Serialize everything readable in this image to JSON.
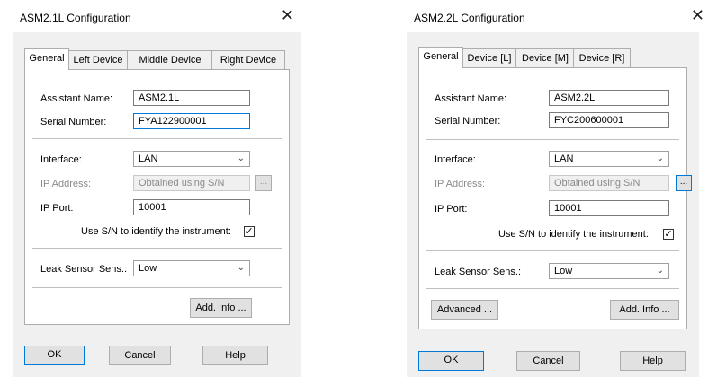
{
  "dialog1": {
    "title": "ASM2.1L Configuration",
    "close": "✕",
    "tabs": [
      "General",
      "Left Device",
      "Middle Device",
      "Right Device"
    ],
    "assistant_name_label": "Assistant Name:",
    "assistant_name_value": "ASM2.1L",
    "serial_number_label": "Serial Number:",
    "serial_number_value": "FYA122900001",
    "interface_label": "Interface:",
    "interface_value": "LAN",
    "ip_address_label": "IP Address:",
    "ip_address_value": "Obtained using S/N",
    "browse_label": "...",
    "ip_port_label": "IP Port:",
    "ip_port_value": "10001",
    "use_sn_label": "Use S/N to identify the instrument:",
    "use_sn_checked": "✓",
    "leak_sensor_label": "Leak Sensor Sens.:",
    "leak_sensor_value": "Low",
    "add_info_label": "Add. Info ...",
    "ok_label": "OK",
    "cancel_label": "Cancel",
    "help_label": "Help"
  },
  "dialog2": {
    "title": "ASM2.2L Configuration",
    "close": "✕",
    "tabs": [
      "General",
      "Device [L]",
      "Device [M]",
      "Device [R]"
    ],
    "assistant_name_label": "Assistant Name:",
    "assistant_name_value": "ASM2.2L",
    "serial_number_label": "Serial Number:",
    "serial_number_value": "FYC200600001",
    "interface_label": "Interface:",
    "interface_value": "LAN",
    "ip_address_label": "IP Address:",
    "ip_address_value": "Obtained using S/N",
    "browse_label": "...",
    "ip_port_label": "IP Port:",
    "ip_port_value": "10001",
    "use_sn_label": "Use S/N to identify the instrument:",
    "use_sn_checked": "✓",
    "leak_sensor_label": "Leak Sensor Sens.:",
    "leak_sensor_value": "Low",
    "advanced_label": "Advanced ...",
    "add_info_label": "Add. Info ...",
    "ok_label": "OK",
    "cancel_label": "Cancel",
    "help_label": "Help"
  },
  "icons": {
    "dropdown": "chevron-down-icon",
    "close": "close-icon",
    "checkbox": "checkmark-icon"
  }
}
